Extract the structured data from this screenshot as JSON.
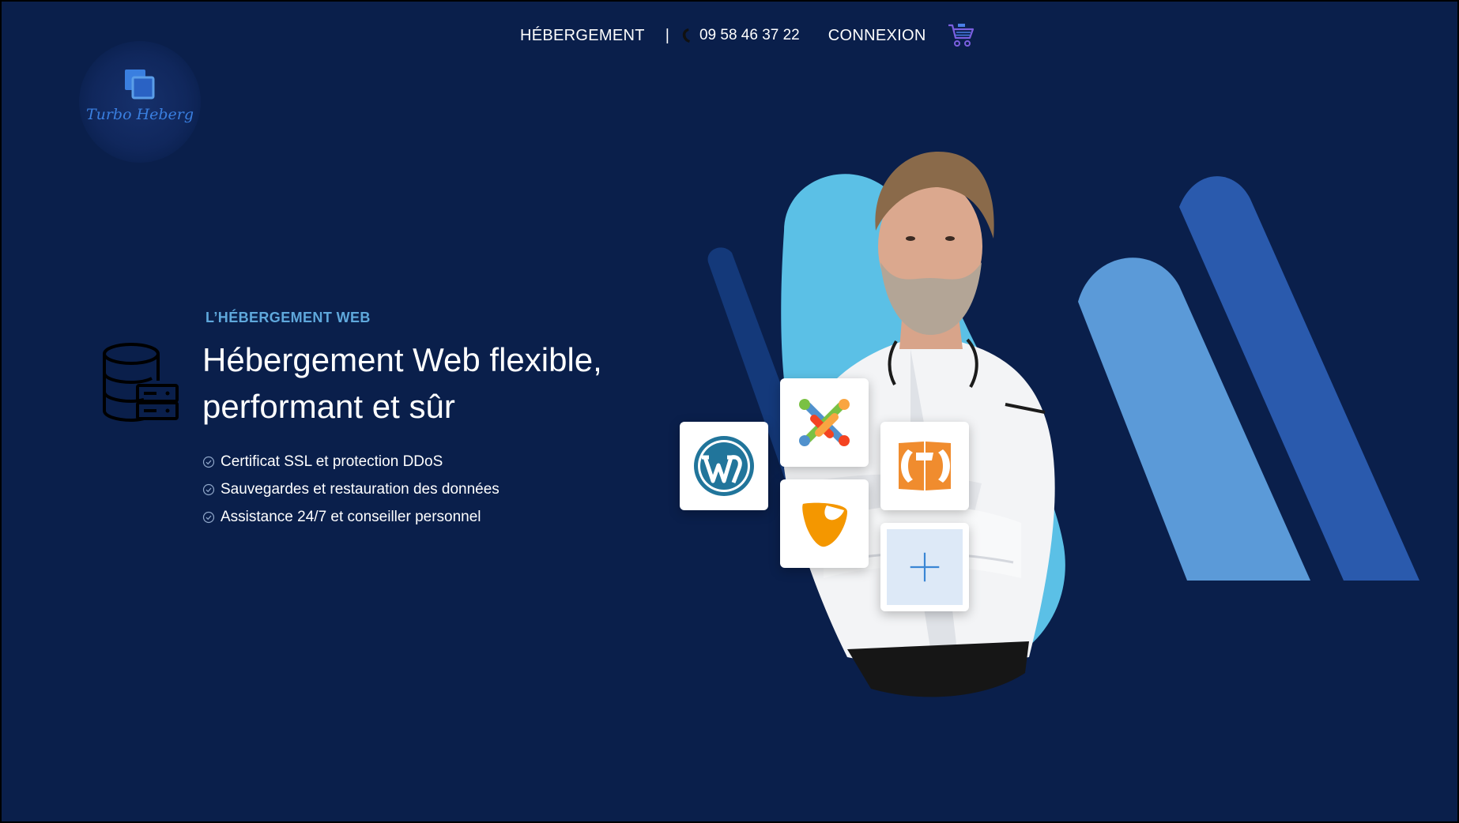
{
  "nav": {
    "hosting": "HÉBERGEMENT",
    "separator": "|",
    "phone": "09 58 46 37 22",
    "login": "CONNEXION"
  },
  "logo": {
    "text": "Turbo Heberg"
  },
  "hero": {
    "eyebrow": "L’HÉBERGEMENT WEB",
    "title_line1": "Hébergement Web flexible,",
    "title_line2": "performant et sûr",
    "features": [
      "Certificat SSL et protection DDoS",
      "Sauvegardes et restauration des données",
      "Assistance 24/7 et conseiller personnel"
    ]
  },
  "apps": [
    {
      "icon": "wordpress-icon"
    },
    {
      "icon": "joomla-icon"
    },
    {
      "icon": "typo3-icon"
    },
    {
      "icon": "concrete-cms-icon"
    },
    {
      "icon": "plus-icon"
    }
  ],
  "colors": {
    "background": "#0a1f4b",
    "accent": "#5fa8dc",
    "light_blue_shape": "#5bc0e6",
    "mid_blue_shape": "#5b9ad8",
    "dark_blue_shape": "#2a5aad",
    "logo_blue": "#3a7fe0"
  }
}
